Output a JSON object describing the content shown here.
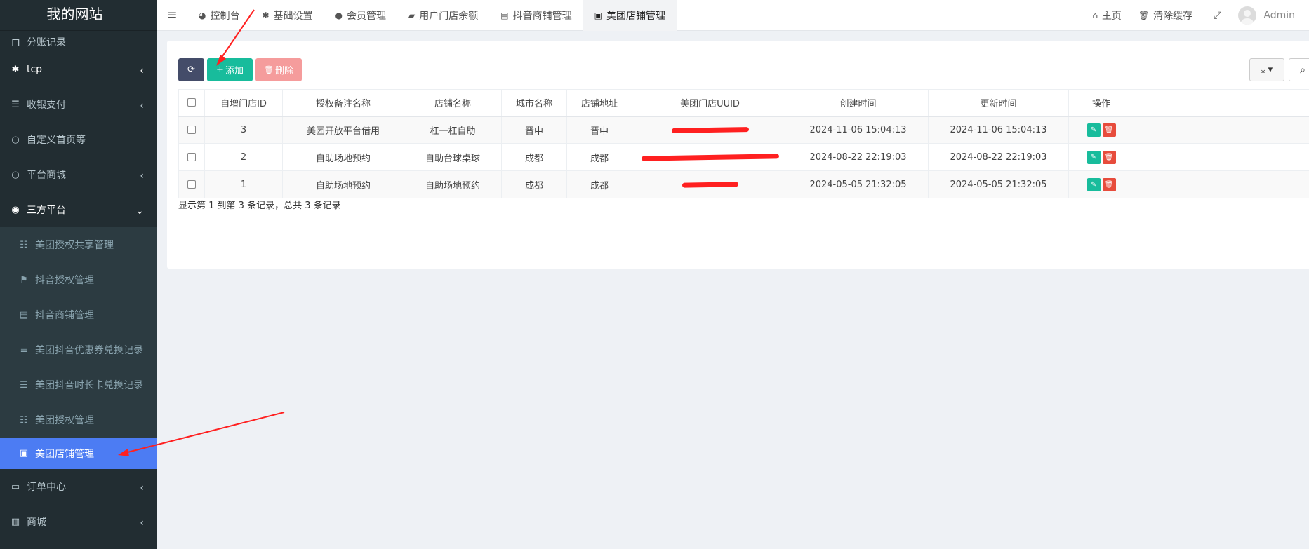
{
  "site": {
    "title": "我的网站"
  },
  "sidebar": {
    "items": [
      {
        "label": "分账记录",
        "icon": "copy-icon"
      },
      {
        "label": "tcp",
        "icon": "asterisk-icon"
      },
      {
        "label": "收银支付",
        "icon": "list-icon"
      },
      {
        "label": "自定义首页等",
        "icon": "circle-icon"
      },
      {
        "label": "平台商城",
        "icon": "circle-icon"
      },
      {
        "label": "三方平台",
        "icon": "eye-icon"
      }
    ],
    "subitems": [
      {
        "label": "美团授权共享管理",
        "icon": "th-list-icon"
      },
      {
        "label": "抖音授权管理",
        "icon": "flag-icon"
      },
      {
        "label": "抖音商铺管理",
        "icon": "archive-icon"
      },
      {
        "label": "美团抖音优惠券兑换记录",
        "icon": "bars-icon"
      },
      {
        "label": "美团抖音时长卡兑换记录",
        "icon": "list-alt-icon"
      },
      {
        "label": "美团授权管理",
        "icon": "th-list-icon"
      },
      {
        "label": "美团店铺管理",
        "icon": "book-icon"
      }
    ],
    "bottom_items": [
      {
        "label": "订单中心",
        "icon": "list-alt-icon"
      },
      {
        "label": "商城",
        "icon": "briefcase-icon"
      }
    ]
  },
  "topnav": {
    "tabs": [
      {
        "label": "控制台",
        "icon": "dashboard-icon"
      },
      {
        "label": "基础设置",
        "icon": "asterisk-icon"
      },
      {
        "label": "会员管理",
        "icon": "user-icon"
      },
      {
        "label": "用户门店余额",
        "icon": "book-icon"
      },
      {
        "label": "抖音商铺管理",
        "icon": "archive-icon"
      },
      {
        "label": "美团店铺管理",
        "icon": "book-icon"
      }
    ],
    "home_label": "主页",
    "clear_cache_label": "清除缓存",
    "user_label": "Admin"
  },
  "toolbar": {
    "add_label": "添加",
    "delete_label": "删除"
  },
  "table": {
    "columns": [
      "自增门店ID",
      "授权备注名称",
      "店铺名称",
      "城市名称",
      "店铺地址",
      "美团门店UUID",
      "创建时间",
      "更新时间",
      "操作"
    ],
    "rows": [
      {
        "id": "3",
        "remark": "美团开放平台借用",
        "shop": "杠一杠自助",
        "city": "晋中",
        "address": "晋中",
        "uuid": "",
        "created": "2024-11-06 15:04:13",
        "updated": "2024-11-06 15:04:13"
      },
      {
        "id": "2",
        "remark": "自助场地预约",
        "shop": "自助台球桌球",
        "city": "成都",
        "address": "成都",
        "uuid": "",
        "created": "2024-08-22 22:19:03",
        "updated": "2024-08-22 22:19:03"
      },
      {
        "id": "1",
        "remark": "自助场地预约",
        "shop": "自助场地预约",
        "city": "成都",
        "address": "成都",
        "uuid": "",
        "created": "2024-05-05 21:32:05",
        "updated": "2024-05-05 21:32:05"
      }
    ]
  },
  "summary": "显示第 1 到第 3 条记录，总共 3 条记录",
  "colors": {
    "sidebar_bg": "#222d32",
    "active_blue": "#4c7cf3",
    "success_green": "#18bc9c",
    "danger_red": "#e74c3c",
    "annotation_red": "#ff2020"
  }
}
